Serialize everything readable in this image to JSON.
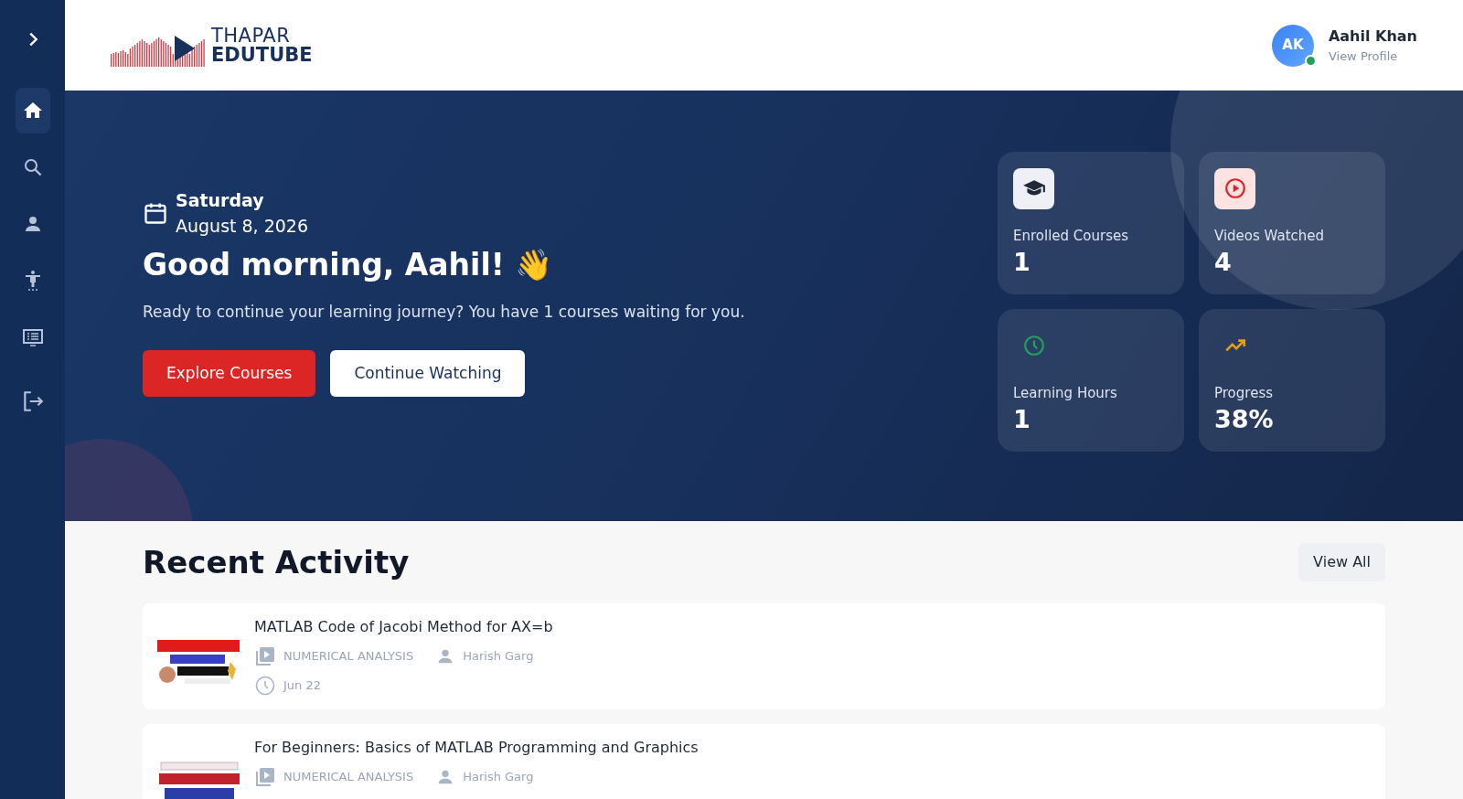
{
  "sidebar": {
    "items": [
      {
        "kind": "home",
        "selected": true
      },
      {
        "kind": "search",
        "selected": false
      },
      {
        "kind": "profile",
        "selected": false
      },
      {
        "kind": "accessibility",
        "selected": false
      },
      {
        "kind": "courses",
        "selected": false
      }
    ]
  },
  "header": {
    "logo": {
      "line1": "THAPAR",
      "line2": "EDUTUBE"
    },
    "user": {
      "initials": "AK",
      "name": "Aahil Khan",
      "link": "View Profile",
      "online": true
    }
  },
  "hero": {
    "day": "Saturday",
    "date": "August 8, 2026",
    "greeting": "Good morning, Aahil! 👋",
    "subtitle": "Ready to continue your learning journey? You have 1 courses waiting for you.",
    "buttons": [
      {
        "label": "Explore Courses",
        "kind": "primary"
      },
      {
        "label": "Continue Watching",
        "kind": "secondary"
      }
    ],
    "stats": [
      {
        "kind": "courses",
        "label": "Enrolled Courses",
        "value": "1"
      },
      {
        "kind": "videos",
        "label": "Videos Watched",
        "value": "4"
      },
      {
        "kind": "hours",
        "label": "Learning Hours",
        "value": "1"
      },
      {
        "kind": "progress",
        "label": "Progress",
        "value": "38%"
      }
    ]
  },
  "recent": {
    "title": "Recent Activity",
    "view_all": "View All",
    "items": [
      {
        "title": "MATLAB Code of Jacobi Method for AX=b",
        "category": "NUMERICAL ANALYSIS",
        "author": "Harish Garg",
        "date": "Jun 22"
      },
      {
        "title": "For Beginners: Basics of MATLAB Programming and Graphics",
        "category": "NUMERICAL ANALYSIS",
        "author": "Harish Garg"
      }
    ]
  }
}
